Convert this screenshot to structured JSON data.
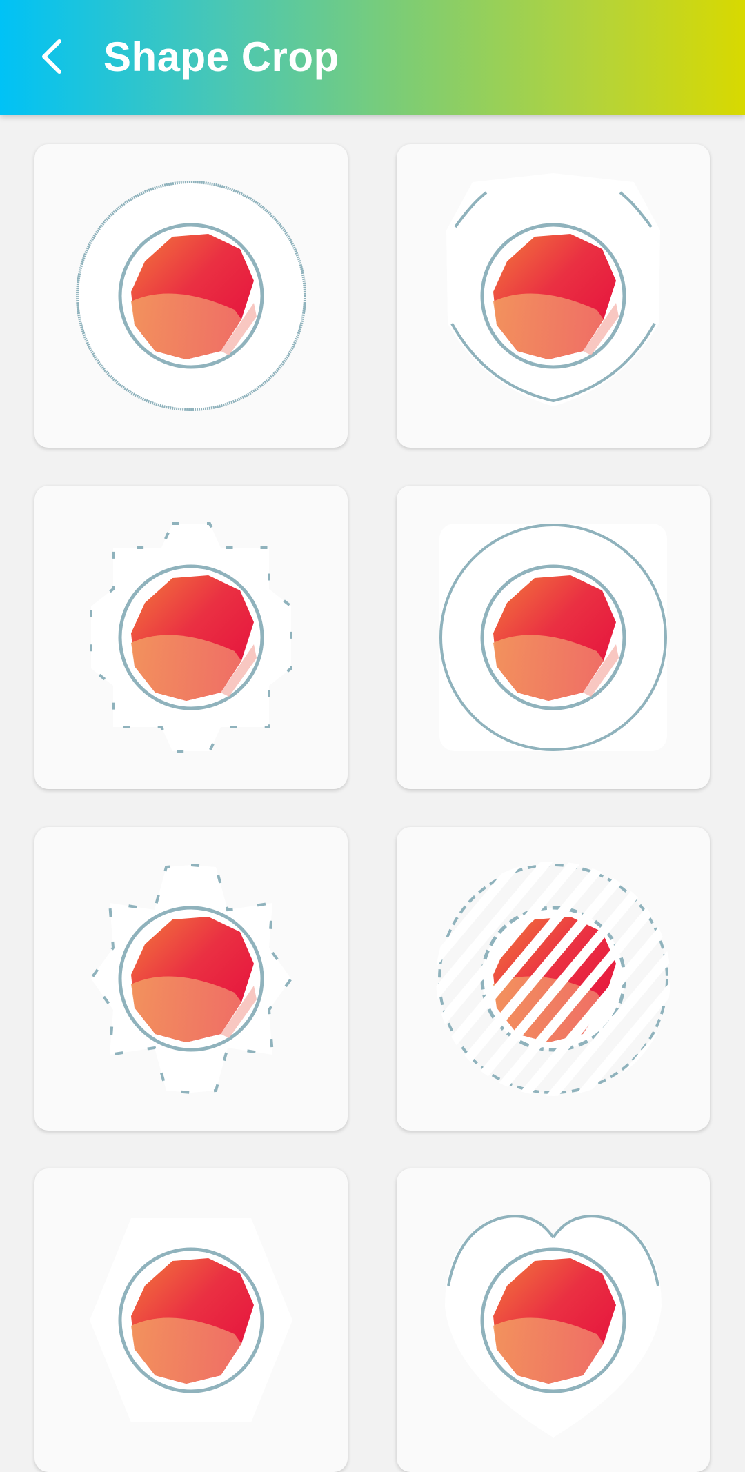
{
  "app_bar": {
    "title": "Shape Crop",
    "back_icon": "back-arrow-icon",
    "gradient": [
      "#00c2f6",
      "#d8d900"
    ]
  },
  "shapes": [
    {
      "name": "circle"
    },
    {
      "name": "shield"
    },
    {
      "name": "gear"
    },
    {
      "name": "rounded-square"
    },
    {
      "name": "star"
    },
    {
      "name": "striped-circle"
    },
    {
      "name": "hexagon"
    },
    {
      "name": "heart"
    }
  ]
}
